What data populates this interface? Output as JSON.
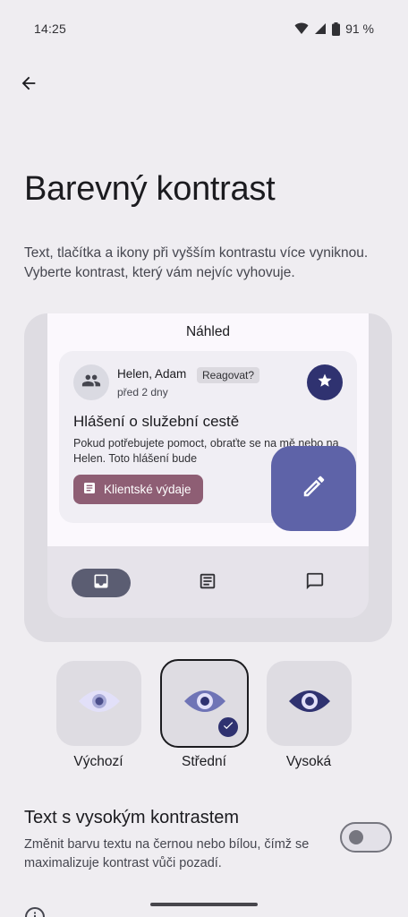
{
  "status_bar": {
    "time": "14:25",
    "battery": "91 %",
    "icons": [
      "wifi-icon",
      "signal-icon",
      "battery-icon"
    ]
  },
  "header": {
    "back_icon": "arrow-back-icon",
    "title": "Barevný kontrast",
    "description": "Text, tlačítka a ikony při vyšším kontrastu více vyniknou. Vyberte kontrast, který vám nejvíc vyhovuje."
  },
  "preview": {
    "heading": "Náhled",
    "email": {
      "sender": "Helen, Adam",
      "badge": "Reagovat?",
      "time": "před 2 dny",
      "subject": "Hlášení o služební cestě",
      "body": "Pokud potřebujete pomoct, obraťte se na mě nebo na Helen. Toto hlášení bude",
      "chip_label": "Klientské výdaje"
    },
    "nav_icons": [
      "inbox-icon",
      "article-icon",
      "chat-icon"
    ]
  },
  "contrast_options": [
    {
      "label": "Výchozí",
      "selected": false
    },
    {
      "label": "Střední",
      "selected": true
    },
    {
      "label": "Vysoká",
      "selected": false
    }
  ],
  "high_contrast_text": {
    "title": "Text s vysokým kontrastem",
    "description": "Změnit barvu textu na černou nebo bílou, čímž se maximalizuje kontrast vůči pozadí.",
    "enabled": false
  },
  "colors": {
    "background": "#EFEDF1",
    "accent_dark": "#2F3270",
    "fab": "#5E63A8",
    "chip": "#8E5E74"
  }
}
